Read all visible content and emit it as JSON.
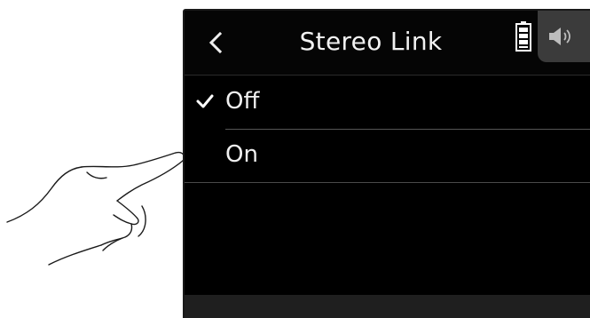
{
  "header": {
    "title": "Stereo Link",
    "back_icon": "chevron-left-icon",
    "battery_icon": "battery-icon",
    "speaker_icon": "speaker-icon"
  },
  "options": [
    {
      "label": "Off",
      "selected": true
    },
    {
      "label": "On",
      "selected": false
    }
  ],
  "colors": {
    "background": "#000000",
    "text": "#f0f0f0",
    "tab": "#3b3b3b",
    "divider": "#555555"
  }
}
